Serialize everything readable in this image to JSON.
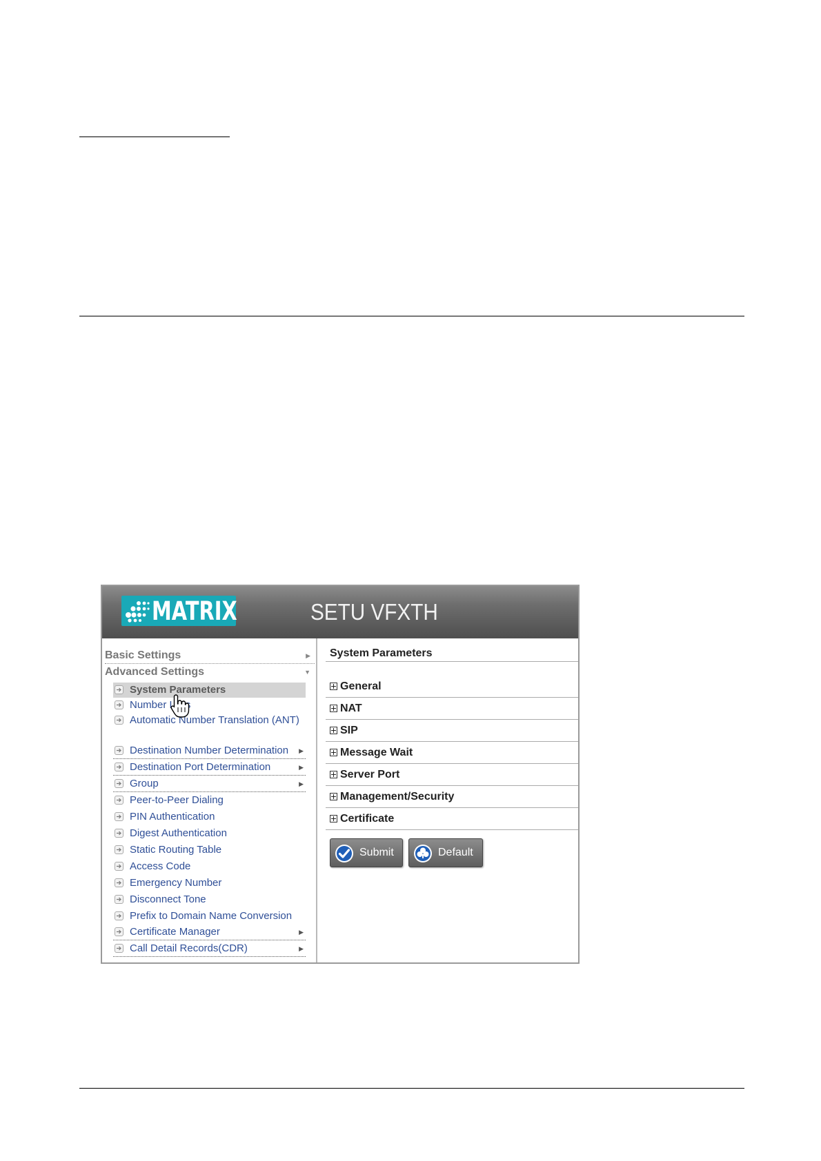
{
  "app": {
    "brand": "MATRIX",
    "product": "SETU VFXTH",
    "colors": {
      "brand_teal": "#19a9b7",
      "header_gray": "#6e6e6e",
      "link_blue": "#2f4f97"
    }
  },
  "sidebar": {
    "basic": {
      "label": "Basic Settings",
      "icon": "arrow-right-icon"
    },
    "advanced": {
      "label": "Advanced Settings",
      "icon": "arrow-down-icon"
    },
    "items": [
      {
        "label": "System Parameters",
        "selected": true
      },
      {
        "label": "Number Lists"
      },
      {
        "label": "Automatic Number Translation (ANT)"
      },
      {
        "label": "Destination Number Determination",
        "submenu": true
      },
      {
        "label": "Destination Port Determination",
        "submenu": true
      },
      {
        "label": "Group",
        "submenu": true
      },
      {
        "label": "Peer-to-Peer Dialing"
      },
      {
        "label": "PIN Authentication"
      },
      {
        "label": "Digest Authentication"
      },
      {
        "label": "Static Routing Table"
      },
      {
        "label": "Access Code"
      },
      {
        "label": "Emergency Number"
      },
      {
        "label": "Disconnect Tone"
      },
      {
        "label": "Prefix to Domain Name Conversion"
      },
      {
        "label": "Certificate Manager",
        "submenu": true
      },
      {
        "label": "Call Detail Records(CDR)",
        "submenu": true
      }
    ]
  },
  "content": {
    "title": "System Parameters",
    "sections": [
      {
        "label": "General"
      },
      {
        "label": "NAT"
      },
      {
        "label": "SIP"
      },
      {
        "label": "Message Wait"
      },
      {
        "label": "Server Port"
      },
      {
        "label": "Management/Security"
      },
      {
        "label": "Certificate"
      }
    ],
    "buttons": {
      "submit": {
        "label": "Submit",
        "icon": "checkmark-icon"
      },
      "default": {
        "label": "Default",
        "icon": "clover-icon"
      }
    }
  }
}
